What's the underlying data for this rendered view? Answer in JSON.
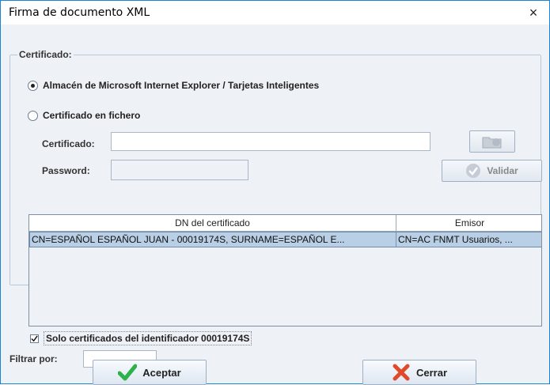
{
  "window": {
    "title": "Firma de documento XML",
    "close_glyph": "×"
  },
  "certificate_group": {
    "title": "Certificado:"
  },
  "options": {
    "store_label": "Almacén de Microsoft Internet Explorer / Tarjetas Inteligentes",
    "file_label": "Certificado en fichero",
    "selected": "store"
  },
  "fields": {
    "certificate_label": "Certificado:",
    "certificate_value": "",
    "password_label": "Password:",
    "password_value": ""
  },
  "buttons": {
    "validate_label": "Validar",
    "accept_label": "Aceptar",
    "cancel_label": "Cerrar"
  },
  "table": {
    "columns": [
      "DN del certificado",
      "Emisor"
    ],
    "rows": [
      [
        "CN=ESPAÑOL ESPAÑOL JUAN - 00019174S, SURNAME=ESPAÑOL E...",
        "CN=AC FNMT Usuarios, ..."
      ]
    ]
  },
  "filter": {
    "only_identifier_label": "Solo certificados del identificador 00019174S",
    "only_identifier_checked": true,
    "filter_label": "Filtrar por:",
    "filter_value": ""
  },
  "icons": {
    "validate": "check-circle-icon",
    "accept": "check-mark-icon",
    "cancel": "x-mark-icon",
    "browse": "folder-icon"
  },
  "colors": {
    "accent_border": "#1883d7",
    "selection": "#b8cfe5",
    "accept_icon": "#2cb24a",
    "cancel_icon": "#e04a2a"
  }
}
